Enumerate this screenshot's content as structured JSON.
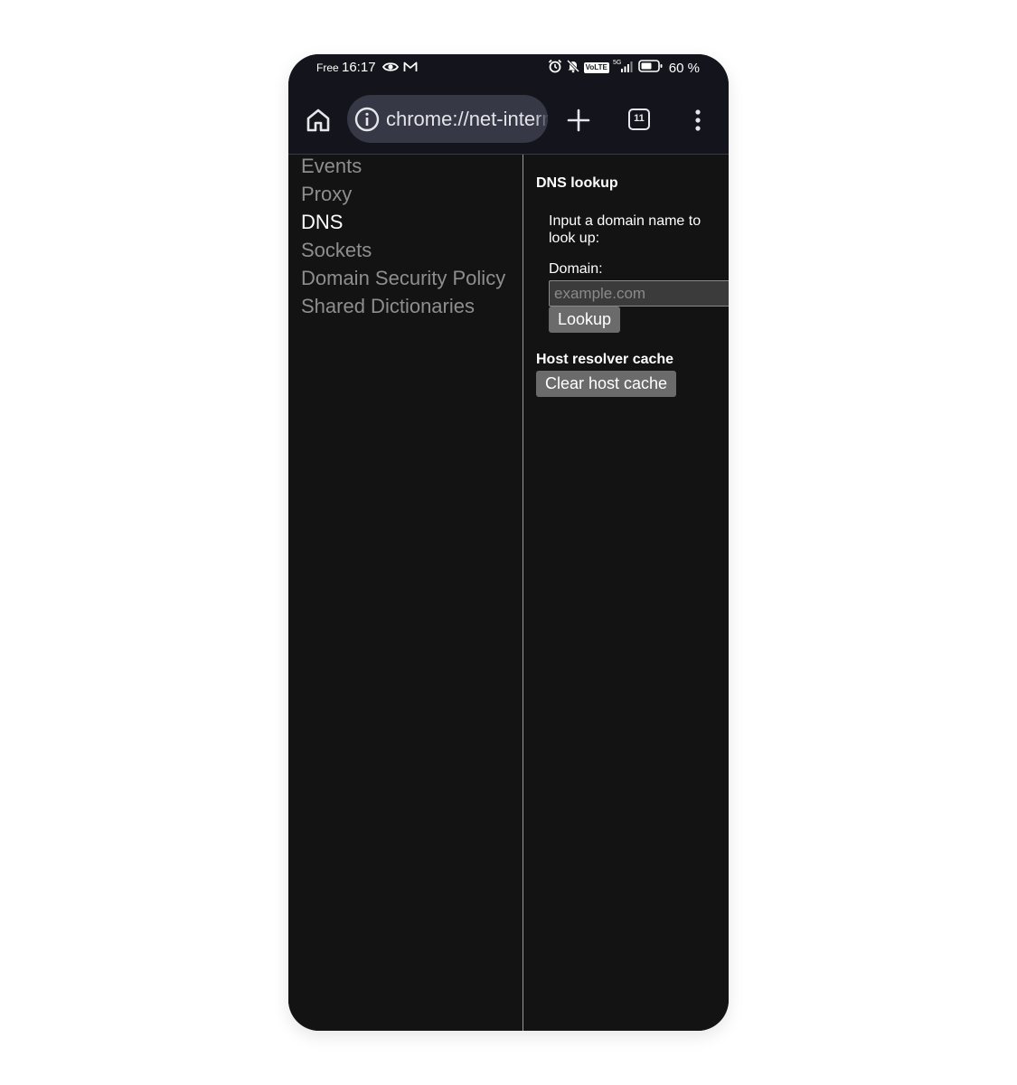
{
  "status_bar": {
    "carrier": "Free",
    "time": "16:17",
    "volte": "VoLTE",
    "network": "5G",
    "battery": "60 %"
  },
  "toolbar": {
    "url": "chrome://net-internals",
    "tab_count": "11",
    "icons": [
      "home-icon",
      "info-icon",
      "plus-icon",
      "tabs-icon",
      "more-vert-icon"
    ]
  },
  "sidebar": {
    "items": [
      {
        "label": "Events",
        "active": false
      },
      {
        "label": "Proxy",
        "active": false
      },
      {
        "label": "DNS",
        "active": true
      },
      {
        "label": "Sockets",
        "active": false
      },
      {
        "label": "Domain Security Policy",
        "active": false
      },
      {
        "label": "Shared Dictionaries",
        "active": false
      }
    ]
  },
  "dns": {
    "title": "DNS lookup",
    "instruction": "Input a domain name to look up:",
    "domain_label": "Domain:",
    "domain_placeholder": "example.com",
    "domain_value": "",
    "lookup_button": "Lookup"
  },
  "cache": {
    "title": "Host resolver cache",
    "clear_button": "Clear host cache"
  },
  "colors": {
    "background": "#131313",
    "toolbar": "#14151c",
    "omnibox": "#363846",
    "nav_inactive": "#8e8e8e",
    "nav_active": "#ffffff",
    "button": "#6b6b6b"
  }
}
